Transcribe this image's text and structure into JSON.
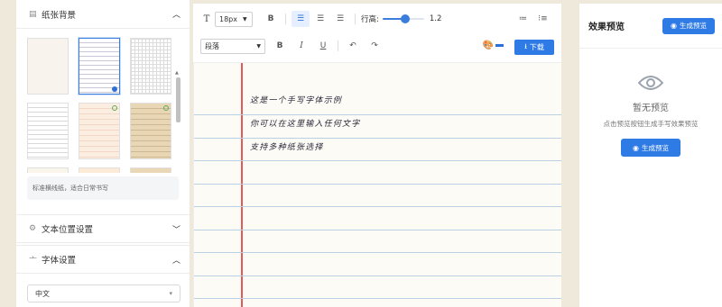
{
  "left": {
    "paper_section": {
      "title": "纸张背景"
    },
    "paper_desc": "标准横线纸，适合日常书写",
    "text_position_section": {
      "title": "文本位置设置"
    },
    "font_section": {
      "title": "字体设置"
    },
    "language_select": {
      "value": "中文"
    }
  },
  "toolbar": {
    "font_size": "18px",
    "bold": "B",
    "line_height_label": "行高:",
    "line_height_value": "1.2",
    "line_height_fraction": 0.55,
    "paragraph_select": "段落",
    "bold2": "B",
    "italic": "I",
    "underline": "U",
    "undo": "↶",
    "redo": "↷",
    "accent_color": "#2d6fd8",
    "download_label": "下载"
  },
  "editor": {
    "lines": [
      "这是一个手写字体示例",
      "你可以在这里输入任何文字",
      "支持多种纸张选择"
    ]
  },
  "preview": {
    "title": "效果预览",
    "generate_label": "生成预览",
    "empty_title": "暂无预览",
    "empty_hint": "点击预览按钮生成手写效果预览",
    "generate_label_2": "生成预览"
  }
}
